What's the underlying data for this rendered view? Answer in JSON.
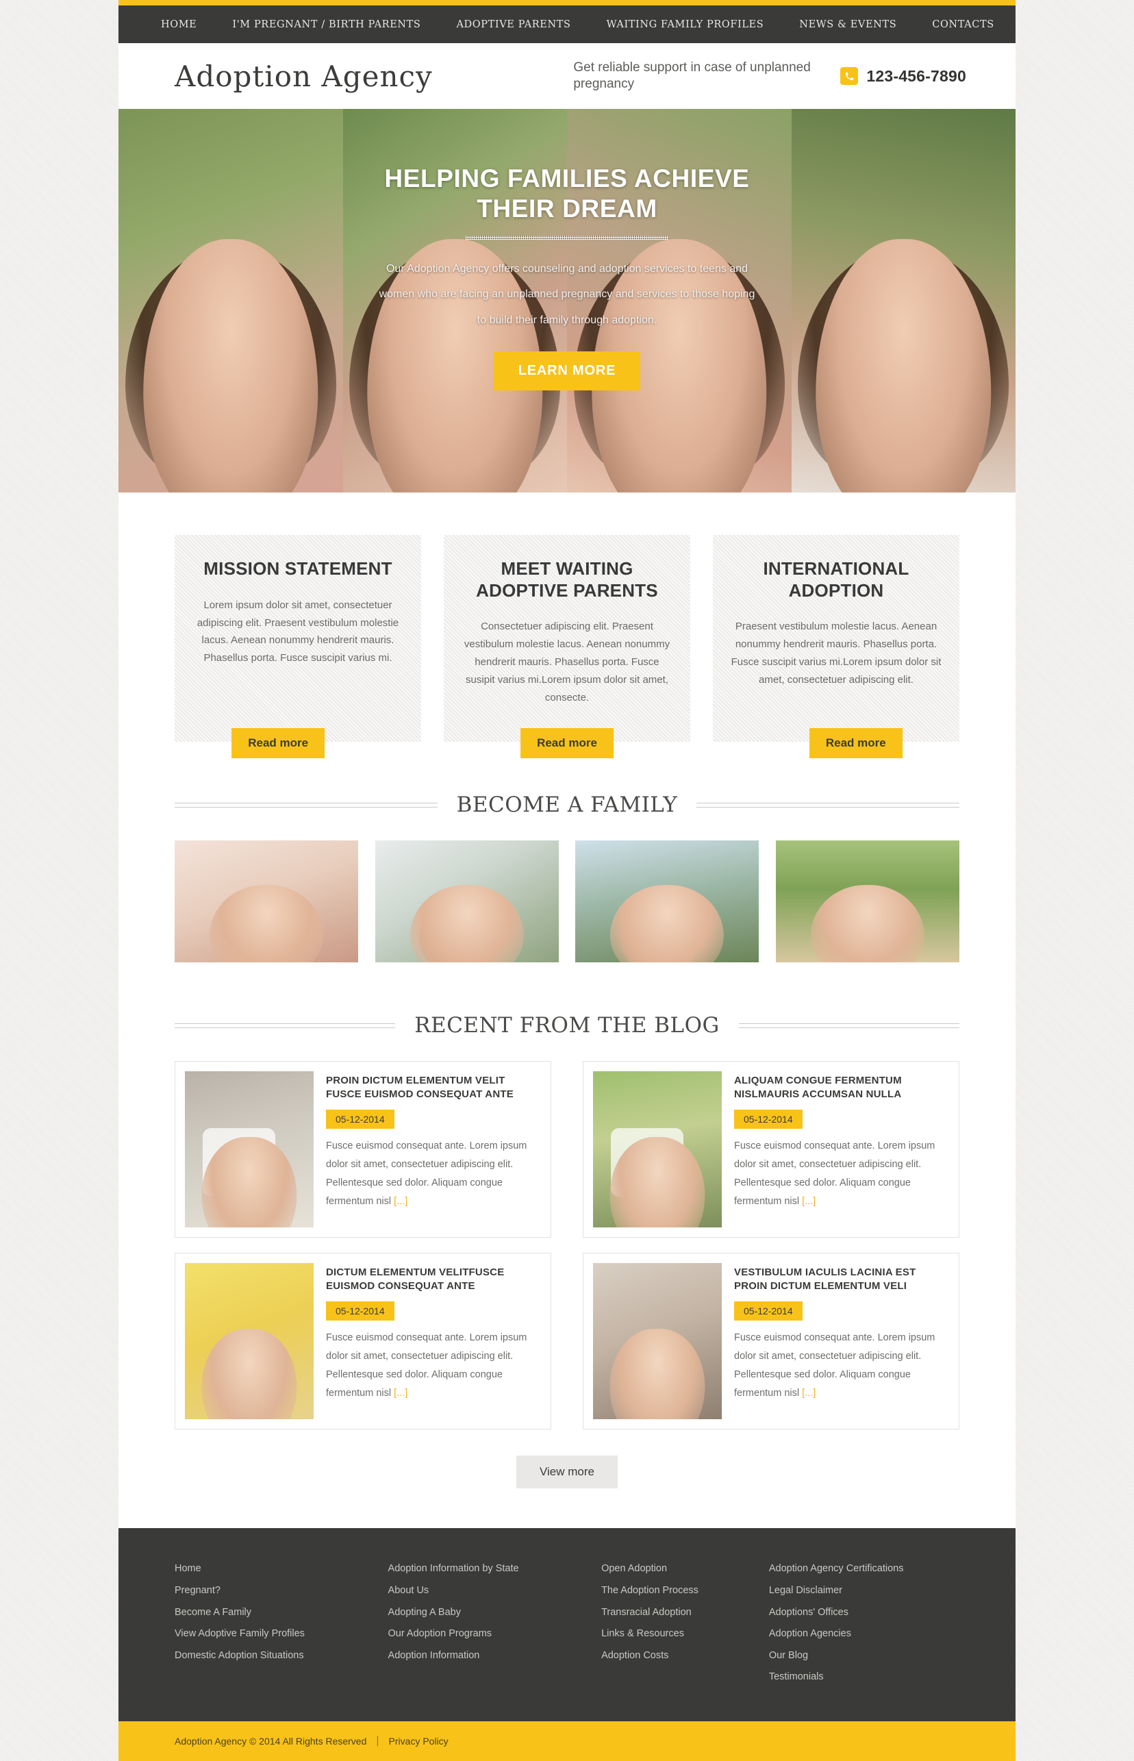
{
  "nav": {
    "items": [
      {
        "label": "HOME"
      },
      {
        "label": "I'M PREGNANT / BIRTH PARENTS"
      },
      {
        "label": "ADOPTIVE PARENTS"
      },
      {
        "label": "WAITING FAMILY PROFILES"
      },
      {
        "label": "NEWS & EVENTS"
      },
      {
        "label": "CONTACTS"
      }
    ]
  },
  "header": {
    "logo": "Adoption Agency",
    "tagline": "Get reliable support in case of unplanned pregnancy",
    "phone": "123-456-7890",
    "phone_icon": "phone-icon"
  },
  "hero": {
    "title": "HELPING FAMILIES ACHIEVE THEIR DREAM",
    "text": "Our Adoption Agency offers counseling and adoption services to teens and women who are facing an unplanned pregnancy and services to those hoping to build their family through adoption.",
    "button": "LEARN MORE"
  },
  "features": [
    {
      "title": "MISSION STATEMENT",
      "text": "Lorem ipsum dolor sit amet, consectetuer adipiscing elit. Praesent vestibulum molestie lacus. Aenean nonummy hendrerit mauris. Phasellus porta. Fusce suscipit varius mi.",
      "button": "Read more"
    },
    {
      "title": "MEET WAITING ADOPTIVE PARENTS",
      "text": "Consectetuer adipiscing elit. Praesent vestibulum molestie lacus. Aenean nonummy hendrerit mauris. Phasellus porta. Fusce susipit varius mi.Lorem ipsum dolor sit amet, consecte.",
      "button": "Read more"
    },
    {
      "title": "INTERNATIONAL ADOPTION",
      "text": "Praesent vestibulum molestie lacus. Aenean nonummy hendrerit mauris. Phasellus porta. Fusce suscipit varius mi.Lorem ipsum dolor sit amet, consectetuer adipiscing elit.",
      "button": "Read more"
    }
  ],
  "become_family": {
    "heading": "BECOME A FAMILY",
    "items": [
      {
        "caption": "baby-drinking-bottle-photo"
      },
      {
        "caption": "father-and-daughter-photo"
      },
      {
        "caption": "family-of-four-photo"
      },
      {
        "caption": "crawling-baby-photo"
      }
    ]
  },
  "blog": {
    "heading": "RECENT FROM THE BLOG",
    "posts": [
      {
        "title": "PROIN DICTUM ELEMENTUM VELIT FUSCE EUISMOD CONSEQUAT ANTE",
        "date": "05-12-2014",
        "excerpt": "Fusce euismod consequat ante. Lorem ipsum dolor sit amet, consectetuer adipiscing elit. Pellentesque sed dolor. Aliquam congue fermentum nisl ",
        "more": "[...]",
        "thumb": "girl-holding-heart-drawing-photo"
      },
      {
        "title": "ALIQUAM CONGUE FERMENTUM NISLMAURIS ACCUMSAN NULLA",
        "date": "05-12-2014",
        "excerpt": "Fusce euismod consequat ante. Lorem ipsum dolor sit amet, consectetuer adipiscing elit. Pellentesque sed dolor. Aliquam congue fermentum nisl ",
        "more": "[...]",
        "thumb": "family-with-dog-photo"
      },
      {
        "title": "DICTUM ELEMENTUM VELITFUSCE EUISMOD CONSEQUAT ANTE",
        "date": "05-12-2014",
        "excerpt": "Fusce euismod consequat ante. Lorem ipsum dolor sit amet, consectetuer adipiscing elit. Pellentesque sed dolor. Aliquam congue fermentum nisl ",
        "more": "[...]",
        "thumb": "mother-and-baby-photo"
      },
      {
        "title": "VESTIBULUM IACULIS LACINIA EST PROIN DICTUM ELEMENTUM VELI",
        "date": "05-12-2014",
        "excerpt": "Fusce euismod consequat ante. Lorem ipsum dolor sit amet, consectetuer adipiscing elit. Pellentesque sed dolor. Aliquam congue fermentum nisl ",
        "more": "[...]",
        "thumb": "parents-kissing-toddler-photo"
      }
    ],
    "view_more": "View more"
  },
  "footer": {
    "columns": [
      {
        "links": [
          {
            "label": "Home"
          },
          {
            "label": "Pregnant?"
          },
          {
            "label": "Become A Family"
          },
          {
            "label": "View Adoptive Family Profiles"
          },
          {
            "label": "Domestic Adoption Situations"
          }
        ]
      },
      {
        "links": [
          {
            "label": "Adoption Information by State"
          },
          {
            "label": "About Us"
          },
          {
            "label": "Adopting A Baby"
          },
          {
            "label": "Our Adoption Programs"
          },
          {
            "label": "Adoption Information"
          }
        ]
      },
      {
        "links": [
          {
            "label": "Open Adoption"
          },
          {
            "label": "The Adoption Process"
          },
          {
            "label": "Transracial Adoption"
          },
          {
            "label": "Links & Resources"
          },
          {
            "label": "Adoption Costs"
          }
        ]
      },
      {
        "links": [
          {
            "label": "Adoption Agency Certifications"
          },
          {
            "label": "Legal Disclaimer"
          },
          {
            "label": "Adoptions' Offices"
          },
          {
            "label": "Adoption Agencies"
          },
          {
            "label": "Our Blog"
          },
          {
            "label": "Testimonials"
          }
        ]
      }
    ]
  },
  "copyright": {
    "text": "Adoption Agency © 2014 All Rights Reserved",
    "separator": "|",
    "privacy": "Privacy Policy"
  },
  "colors": {
    "accent_yellow": "#f9c218",
    "dark": "#3a3a38",
    "box_gray": "#eceae8"
  }
}
